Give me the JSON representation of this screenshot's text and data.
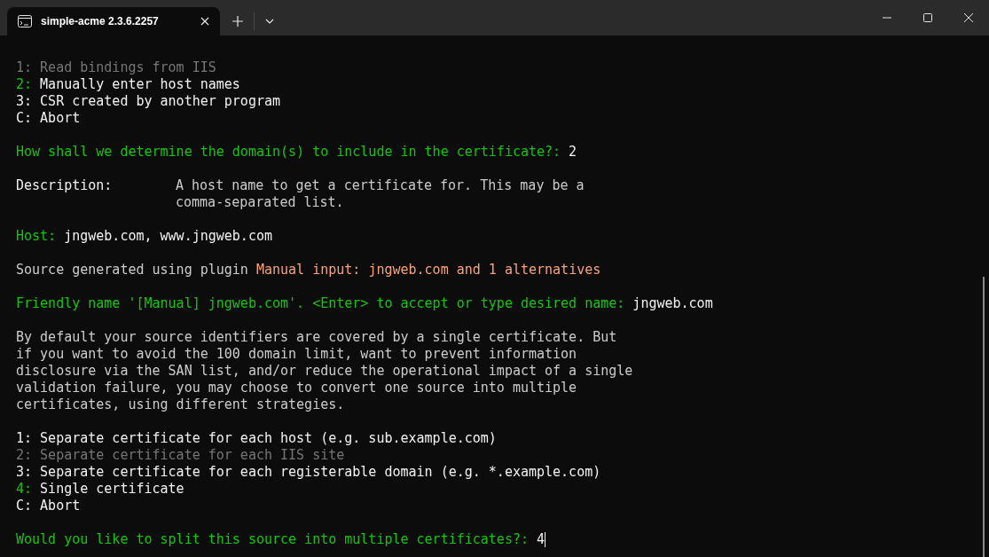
{
  "window": {
    "tab_title": "simple-acme 2.3.6.2257"
  },
  "blocks": [
    {
      "kind": "menu",
      "options": [
        {
          "key": "1:",
          "label": "Read bindings from IIS",
          "selected": false,
          "disabled": true
        },
        {
          "key": "2:",
          "label": "Manually enter host names",
          "selected": true,
          "disabled": false
        },
        {
          "key": "3:",
          "label": "CSR created by another program",
          "selected": false,
          "disabled": false
        },
        {
          "key": "C:",
          "label": "Abort",
          "selected": false,
          "disabled": false
        }
      ]
    },
    {
      "kind": "prompt",
      "question": "How shall we determine the domain(s) to include in the certificate?:",
      "answer": "2",
      "cursor": false
    },
    {
      "kind": "description",
      "label": "Description:",
      "lines": [
        "A host name to get a certificate for. This may be a",
        "comma-separated list."
      ]
    },
    {
      "kind": "prompt",
      "question": "Host:",
      "answer": "jngweb.com, www.jngweb.com",
      "cursor": false
    },
    {
      "kind": "source",
      "text": "Source generated using plugin",
      "plugin": "Manual input:",
      "detail": "jngweb.com and 1 alternatives"
    },
    {
      "kind": "prompt",
      "question": "Friendly name '[Manual] jngweb.com'. <Enter> to accept or type desired name:",
      "answer": "jngweb.com",
      "cursor": false
    },
    {
      "kind": "paragraph",
      "lines": [
        "By default your source identifiers are covered by a single certificate. But",
        "if you want to avoid the 100 domain limit, want to prevent information",
        "disclosure via the SAN list, and/or reduce the operational impact of a single",
        "validation failure, you may choose to convert one source into multiple",
        "certificates, using different strategies."
      ]
    },
    {
      "kind": "menu",
      "options": [
        {
          "key": "1:",
          "label": "Separate certificate for each host (e.g. sub.example.com)",
          "selected": false,
          "disabled": false
        },
        {
          "key": "2:",
          "label": "Separate certificate for each IIS site",
          "selected": false,
          "disabled": true
        },
        {
          "key": "3:",
          "label": "Separate certificate for each registerable domain (e.g. *.example.com)",
          "selected": false,
          "disabled": false
        },
        {
          "key": "4:",
          "label": "Single certificate",
          "selected": true,
          "disabled": false
        },
        {
          "key": "C:",
          "label": "Abort",
          "selected": false,
          "disabled": false
        }
      ]
    },
    {
      "kind": "prompt",
      "question": "Would you like to split this source into multiple certificates?:",
      "answer": "4",
      "cursor": true
    }
  ]
}
